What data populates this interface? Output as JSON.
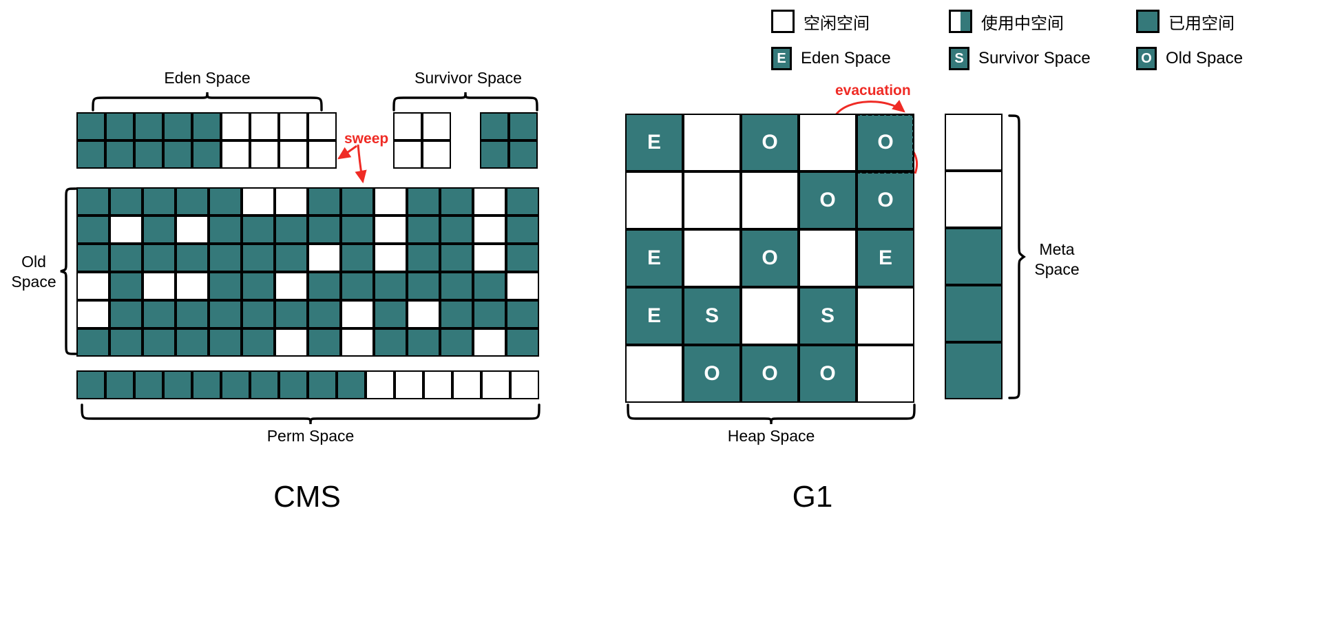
{
  "legend": {
    "rows": [
      [
        {
          "type": "swatch",
          "style": "free",
          "label": "空闲空间",
          "name": "legend-free-space"
        },
        {
          "type": "swatch",
          "style": "half",
          "label": "使用中空间",
          "name": "legend-in-use-space"
        },
        {
          "type": "swatch",
          "style": "used",
          "label": "已用空间",
          "name": "legend-used-space"
        }
      ],
      [
        {
          "type": "tag",
          "tag": "E",
          "label": "Eden Space",
          "name": "legend-eden-space"
        },
        {
          "type": "tag",
          "tag": "S",
          "label": "Survivor Space",
          "name": "legend-survivor-space"
        },
        {
          "type": "tag",
          "tag": "O",
          "label": "Old Space",
          "name": "legend-old-space"
        }
      ]
    ]
  },
  "colors": {
    "used": "#35797a",
    "free": "#ffffff",
    "stroke": "#000000",
    "accent_red": "#ef2b25"
  },
  "cms": {
    "title": "CMS",
    "labels": {
      "eden": "Eden Space",
      "survivor": "Survivor Space",
      "old_line1": "Old",
      "old_line2": "Space",
      "perm": "Perm Space",
      "sweep": "sweep"
    },
    "eden": {
      "cols": 9,
      "rows": 2,
      "cells": [
        [
          1,
          1,
          1,
          1,
          1,
          0,
          0,
          0,
          0
        ],
        [
          1,
          1,
          1,
          1,
          1,
          0,
          0,
          0,
          0
        ]
      ]
    },
    "survivor_a": {
      "cols": 2,
      "rows": 2,
      "cells": [
        [
          0,
          0
        ],
        [
          0,
          0
        ]
      ]
    },
    "survivor_b": {
      "cols": 2,
      "rows": 2,
      "cells": [
        [
          1,
          1
        ],
        [
          1,
          1
        ]
      ]
    },
    "old": {
      "cols": 14,
      "rows": 6,
      "cells": [
        [
          1,
          1,
          1,
          1,
          1,
          0,
          0,
          1,
          1,
          0,
          1,
          1,
          0,
          1
        ],
        [
          1,
          0,
          1,
          0,
          1,
          1,
          1,
          1,
          1,
          0,
          1,
          1,
          0,
          1
        ],
        [
          1,
          1,
          1,
          1,
          1,
          1,
          1,
          0,
          1,
          0,
          1,
          1,
          0,
          1
        ],
        [
          0,
          1,
          0,
          0,
          1,
          1,
          0,
          1,
          1,
          1,
          1,
          1,
          1,
          0
        ],
        [
          0,
          1,
          1,
          1,
          1,
          1,
          1,
          1,
          0,
          1,
          0,
          1,
          1,
          1
        ],
        [
          1,
          1,
          1,
          1,
          1,
          1,
          0,
          1,
          0,
          1,
          1,
          1,
          0,
          1
        ]
      ]
    },
    "perm": {
      "cols": 16,
      "rows": 1,
      "cells": [
        [
          1,
          1,
          1,
          1,
          1,
          1,
          1,
          1,
          1,
          1,
          0,
          0,
          0,
          0,
          0,
          0
        ]
      ]
    }
  },
  "g1": {
    "title": "G1",
    "labels": {
      "heap": "Heap Space",
      "meta_line1": "Meta",
      "meta_line2": "Space",
      "evacuation": "evacuation"
    },
    "heap": {
      "cols": 5,
      "rows": 5,
      "cells": [
        [
          {
            "used": true,
            "tag": "E"
          },
          {
            "used": false,
            "tag": ""
          },
          {
            "used": true,
            "tag": "O"
          },
          {
            "used": false,
            "tag": ""
          },
          {
            "used": true,
            "tag": "O"
          },
          {
            "used": true,
            "tag": "",
            "dashed": true
          }
        ],
        [
          {
            "used": false,
            "tag": ""
          },
          {
            "used": false,
            "tag": ""
          },
          {
            "used": false,
            "tag": ""
          },
          {
            "used": true,
            "tag": "O"
          },
          {
            "used": true,
            "tag": "O"
          }
        ],
        [
          {
            "used": true,
            "tag": "E"
          },
          {
            "used": false,
            "tag": ""
          },
          {
            "used": true,
            "tag": "O"
          },
          {
            "used": false,
            "tag": ""
          },
          {
            "used": true,
            "tag": "E"
          }
        ],
        [
          {
            "used": true,
            "tag": "E"
          },
          {
            "used": true,
            "tag": "S"
          },
          {
            "used": false,
            "tag": ""
          },
          {
            "used": true,
            "tag": "S"
          },
          {
            "used": false,
            "tag": ""
          }
        ],
        [
          {
            "used": false,
            "tag": ""
          },
          {
            "used": true,
            "tag": "O"
          },
          {
            "used": true,
            "tag": "O"
          },
          {
            "used": true,
            "tag": "O"
          },
          {
            "used": false,
            "tag": ""
          }
        ]
      ]
    },
    "meta": {
      "cols": 1,
      "rows": 5,
      "cells": [
        [
          0
        ],
        [
          0
        ],
        [
          1
        ],
        [
          1
        ],
        [
          1
        ]
      ]
    }
  }
}
